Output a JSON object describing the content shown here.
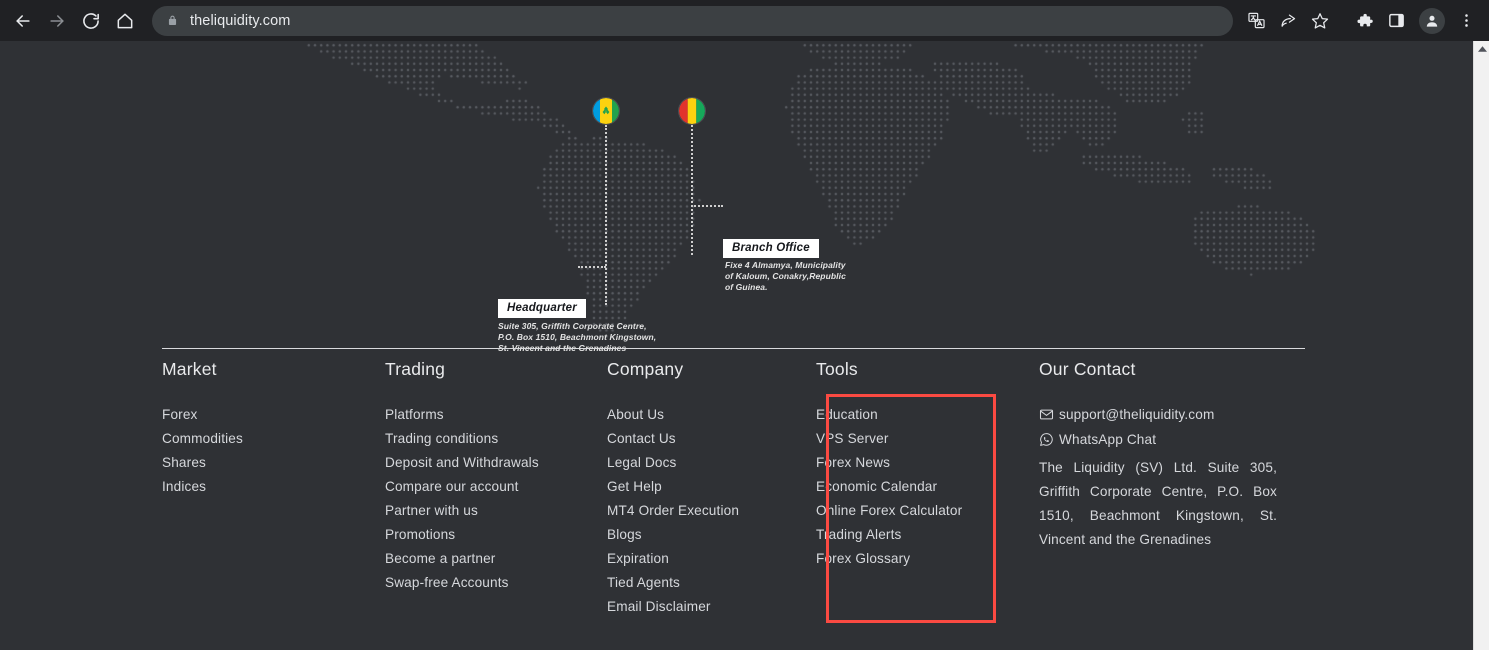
{
  "browser": {
    "url": "theliquidity.com",
    "back_label": "Back",
    "forward_label": "Forward",
    "reload_label": "Reload",
    "home_label": "Home",
    "lock_icon": "lock-icon",
    "translate_label": "Translate this page",
    "share_label": "Share this page",
    "bookmark_label": "Bookmark this tab",
    "extensions_label": "Extensions",
    "side_panel_label": "Side panel",
    "profile_label": "Profile",
    "menu_label": "Customize and control Google Chrome"
  },
  "map": {
    "headquarter": {
      "label": "Headquarter",
      "address": "Suite 305, Griffith Corporate Centre,\nP.O. Box 1510, Beachmont Kingstown,\nSt. Vincent and the Grenadines",
      "flag": "saint-vincent-flag"
    },
    "branch": {
      "label": "Branch Office",
      "address": "Fixe  4 Almamya, Municipality\nof Kaloum,  Conakry,Republic\nof Guinea.",
      "flag": "guinea-flag"
    }
  },
  "footer": {
    "columns": [
      {
        "id": "market",
        "title": "Market",
        "links": [
          "Forex",
          "Commodities",
          "Shares",
          "Indices"
        ]
      },
      {
        "id": "trading",
        "title": "Trading",
        "links": [
          "Platforms",
          "Trading conditions",
          "Deposit and Withdrawals",
          "Compare our account",
          "Partner with us",
          "Promotions",
          "Become a partner",
          "Swap-free Accounts"
        ]
      },
      {
        "id": "company",
        "title": "Company",
        "links": [
          "About Us",
          "Contact Us",
          "Legal  Docs",
          "Get  Help",
          "MT4 Order  Execution",
          "Blogs",
          "Expiration",
          "Tied Agents",
          "Email  Disclaimer"
        ]
      },
      {
        "id": "tools",
        "title": "Tools",
        "links": [
          "Education",
          "VPS Server",
          "Forex  News",
          "Economic Calendar",
          "Online  Forex Calculator",
          "Trading Alerts",
          "Forex Glossary"
        ],
        "highlighted": true,
        "highlight_color": "#fb4a42"
      }
    ],
    "contact": {
      "title": "Our Contact",
      "email": "support@theliquidity.com",
      "email_icon": "email-icon",
      "whatsapp": "WhatsApp Chat",
      "whatsapp_icon": "whatsapp-icon",
      "address": "The   Liquidity   (SV)   Ltd.  Suite   305, Griffith  Corporate  Centre,  P.O.  Box 1510, Beachmont  Kingstown, St. Vincent and the Grenadines"
    }
  },
  "theme": {
    "page_background": "#2f3135",
    "chrome_background": "#202124",
    "text_primary": "#d6d8dc",
    "accent_highlight": "#fb4a42"
  }
}
